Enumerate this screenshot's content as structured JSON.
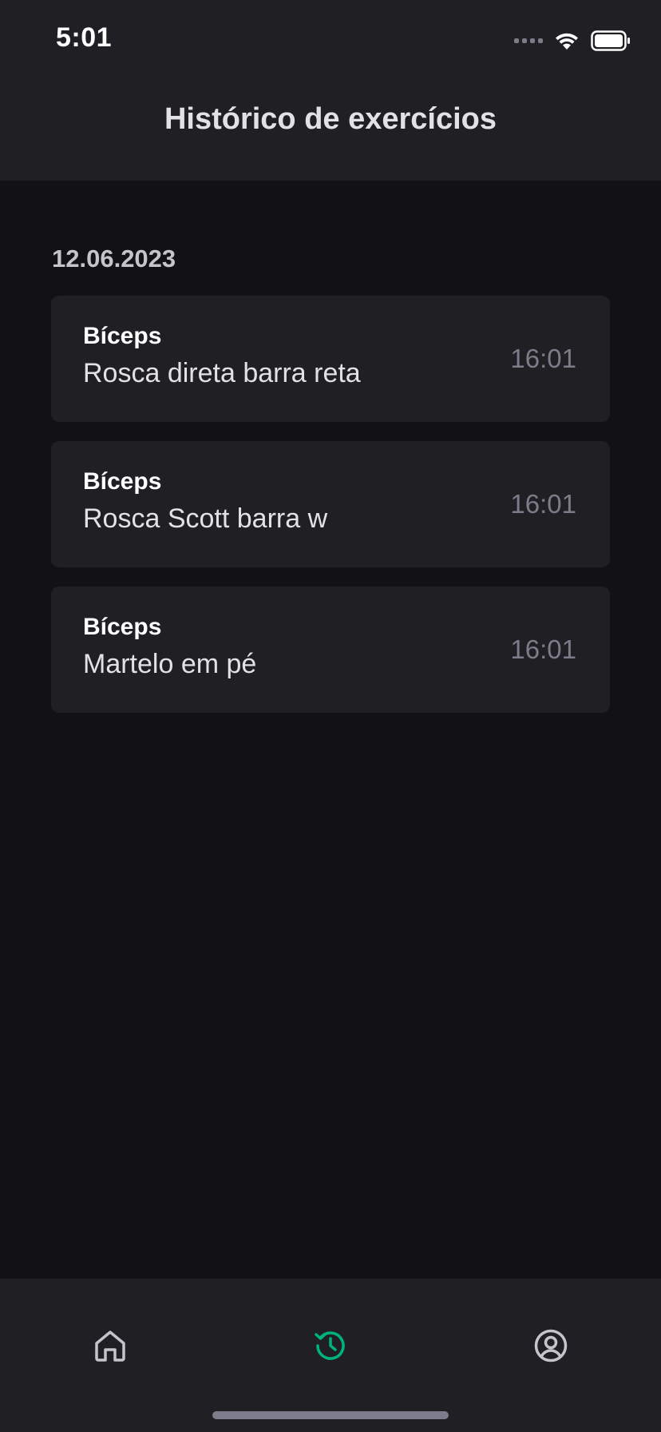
{
  "status_bar": {
    "time": "5:01"
  },
  "header": {
    "title": "Histórico de exercícios"
  },
  "history": {
    "date": "12.06.2023",
    "items": [
      {
        "group": "Bíceps",
        "name": "Rosca direta barra reta",
        "time": "16:01"
      },
      {
        "group": "Bíceps",
        "name": "Rosca Scott barra w",
        "time": "16:01"
      },
      {
        "group": "Bíceps",
        "name": "Martelo em pé",
        "time": "16:01"
      }
    ]
  },
  "tab_bar": {
    "tabs": [
      {
        "icon": "home-icon",
        "active": false
      },
      {
        "icon": "history-icon",
        "active": true
      },
      {
        "icon": "profile-icon",
        "active": false
      }
    ]
  },
  "colors": {
    "background": "#121214",
    "surface": "#202024",
    "accent": "#00B37E",
    "text_primary": "#E1E1E6",
    "text_muted": "#7C7C8A"
  }
}
